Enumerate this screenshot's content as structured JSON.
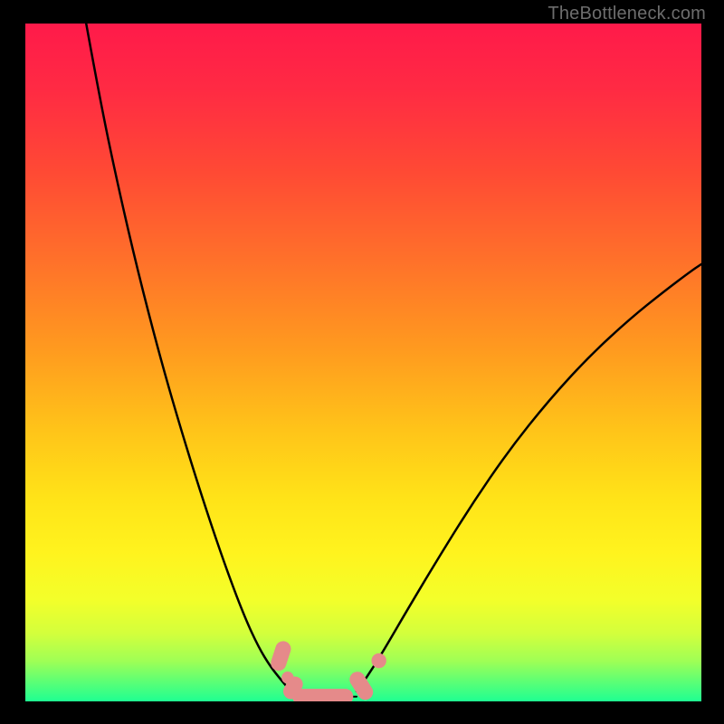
{
  "watermark": "TheBottleneck.com",
  "gradient": {
    "stops": [
      {
        "offset": "0%",
        "color": "#ff1a4a"
      },
      {
        "offset": "10%",
        "color": "#ff2b43"
      },
      {
        "offset": "22%",
        "color": "#ff4a34"
      },
      {
        "offset": "35%",
        "color": "#ff712a"
      },
      {
        "offset": "48%",
        "color": "#ff9a1f"
      },
      {
        "offset": "60%",
        "color": "#ffc419"
      },
      {
        "offset": "70%",
        "color": "#ffe318"
      },
      {
        "offset": "78%",
        "color": "#fff31e"
      },
      {
        "offset": "85%",
        "color": "#f3ff2a"
      },
      {
        "offset": "90%",
        "color": "#d3ff3c"
      },
      {
        "offset": "94%",
        "color": "#a0ff55"
      },
      {
        "offset": "97%",
        "color": "#5eff74"
      },
      {
        "offset": "100%",
        "color": "#1fff92"
      }
    ]
  },
  "chart_data": {
    "type": "line",
    "title": "",
    "xlabel": "",
    "ylabel": "",
    "xlim": [
      0,
      1
    ],
    "ylim": [
      0,
      1
    ],
    "series": [
      {
        "name": "left-curve",
        "x": [
          0.09,
          0.11,
          0.135,
          0.165,
          0.2,
          0.235,
          0.27,
          0.3,
          0.325,
          0.345,
          0.362,
          0.378,
          0.39,
          0.4
        ],
        "y": [
          1.0,
          0.89,
          0.77,
          0.64,
          0.505,
          0.385,
          0.275,
          0.188,
          0.123,
          0.08,
          0.052,
          0.032,
          0.018,
          0.012
        ]
      },
      {
        "name": "right-curve",
        "x": [
          0.49,
          0.505,
          0.53,
          0.565,
          0.61,
          0.66,
          0.715,
          0.775,
          0.835,
          0.895,
          0.945,
          0.985,
          1.0
        ],
        "y": [
          0.015,
          0.035,
          0.075,
          0.135,
          0.21,
          0.29,
          0.37,
          0.445,
          0.51,
          0.565,
          0.605,
          0.635,
          0.645
        ]
      },
      {
        "name": "flat-minimum",
        "x": [
          0.4,
          0.49
        ],
        "y": [
          0.007,
          0.007
        ]
      }
    ],
    "markers": [
      {
        "name": "left-rounded-rect-1",
        "shape": "rounded-rect",
        "cx": 0.378,
        "cy": 0.067,
        "deg": -72,
        "len": 0.045,
        "thick": 0.023
      },
      {
        "name": "left-round-dot-1",
        "shape": "circle",
        "cx": 0.388,
        "cy": 0.035,
        "r": 0.009
      },
      {
        "name": "left-rounded-rect-2",
        "shape": "rounded-rect",
        "cx": 0.396,
        "cy": 0.02,
        "deg": -60,
        "len": 0.035,
        "thick": 0.023
      },
      {
        "name": "bottom-rounded-rect",
        "shape": "rounded-rect",
        "cx": 0.44,
        "cy": 0.007,
        "deg": 0,
        "len": 0.09,
        "thick": 0.023
      },
      {
        "name": "right-rounded-rect",
        "shape": "rounded-rect",
        "cx": 0.497,
        "cy": 0.023,
        "deg": 58,
        "len": 0.045,
        "thick": 0.023
      },
      {
        "name": "right-round-dot",
        "shape": "circle",
        "cx": 0.523,
        "cy": 0.06,
        "r": 0.011
      }
    ],
    "marker_color": "#e58a8a"
  }
}
